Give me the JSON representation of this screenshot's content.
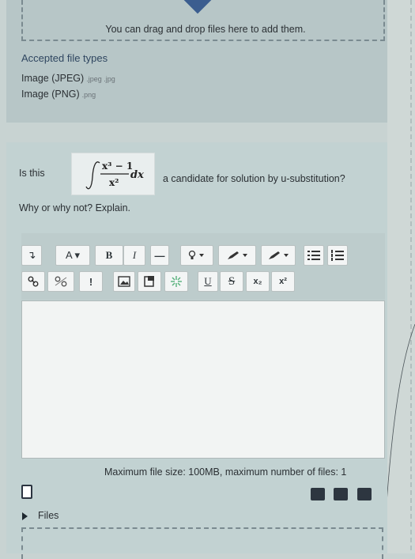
{
  "upload": {
    "drop_text": "You can drag and drop files here to add them.",
    "accepted_title": "Accepted file types",
    "types": [
      {
        "name": "Image (JPEG)",
        "ext": ".jpeg .jpg"
      },
      {
        "name": "Image (PNG)",
        "ext": ".png"
      }
    ]
  },
  "question": {
    "prefix": "Is this",
    "suffix": "a candidate for solution by u-substitution?",
    "prompt": "Why or why not? Explain.",
    "formula": {
      "numerator": "x³ − 1",
      "denominator": "x²",
      "differential": "dx"
    }
  },
  "toolbar": {
    "row1": [
      {
        "id": "toggle",
        "label": "↴"
      },
      {
        "id": "font-style",
        "label": "A ▾"
      },
      {
        "id": "bold",
        "label": "B"
      },
      {
        "id": "italic",
        "label": "I"
      },
      {
        "id": "hr",
        "label": "—"
      }
    ],
    "row2": [
      {
        "id": "emoji",
        "label": "!"
      },
      {
        "id": "underline",
        "label": "U"
      },
      {
        "id": "strike",
        "label": "S"
      },
      {
        "id": "subscript",
        "label": "x₂"
      },
      {
        "id": "superscript",
        "label": "x²"
      }
    ]
  },
  "footer": {
    "max_size": "Maximum file size: 100MB, maximum number of files: 1",
    "files_label": "Files"
  },
  "colors": {
    "panel": "#c2d2d2",
    "editor": "#f2f4f3",
    "accent": "#3b5d8f"
  }
}
